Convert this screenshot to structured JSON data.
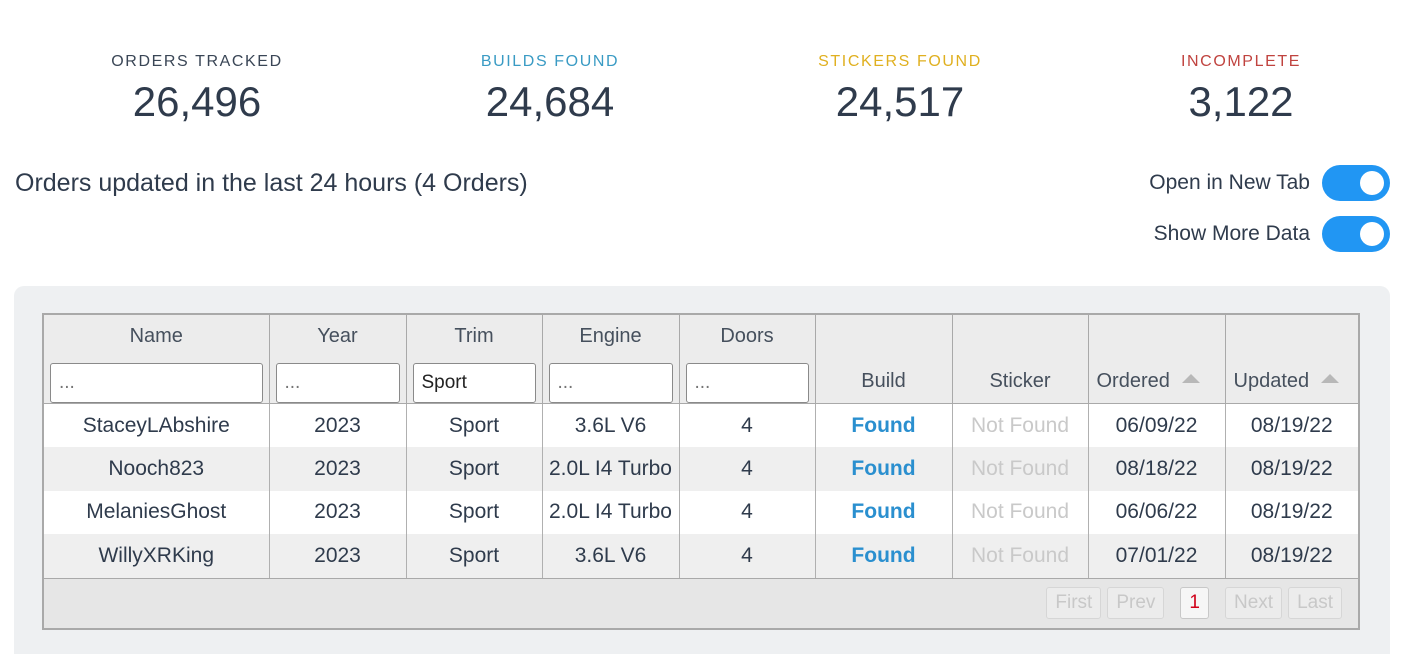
{
  "stats": [
    {
      "label": "ORDERS TRACKED",
      "value": "26,496",
      "color": "#3a4656"
    },
    {
      "label": "BUILDS FOUND",
      "value": "24,684",
      "color": "#3a9bc4"
    },
    {
      "label": "STICKERS FOUND",
      "value": "24,517",
      "color": "#e0b020"
    },
    {
      "label": "INCOMPLETE",
      "value": "3,122",
      "color": "#c0433f"
    }
  ],
  "heading": "Orders updated in the last 24 hours (4 Orders)",
  "toggles": {
    "open_new_tab": {
      "label": "Open in New Tab",
      "on": true
    },
    "show_more_data": {
      "label": "Show More Data",
      "on": true
    }
  },
  "table": {
    "columns": {
      "name": "Name",
      "year": "Year",
      "trim": "Trim",
      "engine": "Engine",
      "doors": "Doors",
      "build": "Build",
      "sticker": "Sticker",
      "ordered": "Ordered",
      "updated": "Updated"
    },
    "filters": {
      "name": {
        "placeholder": "...",
        "value": ""
      },
      "year": {
        "placeholder": "...",
        "value": ""
      },
      "trim": {
        "placeholder": "...",
        "value": "Sport"
      },
      "engine": {
        "placeholder": "...",
        "value": ""
      },
      "doors": {
        "placeholder": "...",
        "value": ""
      }
    },
    "rows": [
      {
        "name": "StaceyLAbshire",
        "year": "2023",
        "trim": "Sport",
        "engine": "3.6L V6",
        "doors": "4",
        "build": "Found",
        "sticker": "Not Found",
        "ordered": "06/09/22",
        "updated": "08/19/22"
      },
      {
        "name": "Nooch823",
        "year": "2023",
        "trim": "Sport",
        "engine": "2.0L I4 Turbo",
        "doors": "4",
        "build": "Found",
        "sticker": "Not Found",
        "ordered": "08/18/22",
        "updated": "08/19/22"
      },
      {
        "name": "MelaniesGhost",
        "year": "2023",
        "trim": "Sport",
        "engine": "2.0L I4 Turbo",
        "doors": "4",
        "build": "Found",
        "sticker": "Not Found",
        "ordered": "06/06/22",
        "updated": "08/19/22"
      },
      {
        "name": "WillyXRKing",
        "year": "2023",
        "trim": "Sport",
        "engine": "3.6L V6",
        "doors": "4",
        "build": "Found",
        "sticker": "Not Found",
        "ordered": "07/01/22",
        "updated": "08/19/22"
      }
    ]
  },
  "pagination": {
    "first": "First",
    "prev": "Prev",
    "current": "1",
    "next": "Next",
    "last": "Last"
  }
}
